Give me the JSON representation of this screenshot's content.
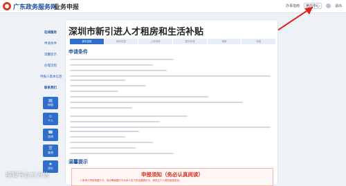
{
  "header": {
    "site_name": "广东政务服务网",
    "module_name": "业务申报",
    "links": {
      "left": "办事指南",
      "user_center": "用户中心",
      "right": "退出"
    }
  },
  "left_nav": {
    "items": [
      {
        "label": "在线服务"
      },
      {
        "label": "申请条件"
      },
      {
        "label": "温馨提示"
      },
      {
        "label": "办理流程"
      },
      {
        "label": "申报人基本信息"
      },
      {
        "label": "联系我们"
      }
    ],
    "buttons": [
      {
        "icon": "document-icon",
        "label": "申报"
      },
      {
        "icon": "person-icon",
        "label": "个人"
      },
      {
        "icon": "phone-icon",
        "label": "咨询"
      },
      {
        "icon": "list-icon",
        "label": "查询"
      },
      {
        "icon": "star-icon",
        "label": "评价"
      }
    ]
  },
  "main": {
    "title": "深圳市新引进人才租房和生活补贴",
    "steps": [
      "事先告知",
      "填写信息",
      "上传材料",
      "提交申请",
      "审核",
      "完成"
    ],
    "conditions_heading": "申请条件",
    "tips_heading": "温馨提示",
    "notice": {
      "title": "申报须知（务必认真阅读）",
      "line1": "1.申请人须持有银行卡，务必确保银行卡为本人名下的全国借记卡，请关注个人财务信息安全。"
    }
  },
  "watermark": "搜狐号@立方信",
  "colors": {
    "brand_blue": "#1c4f9c",
    "nav_blue": "#2f6fc9",
    "notice_red": "#d9331f"
  }
}
